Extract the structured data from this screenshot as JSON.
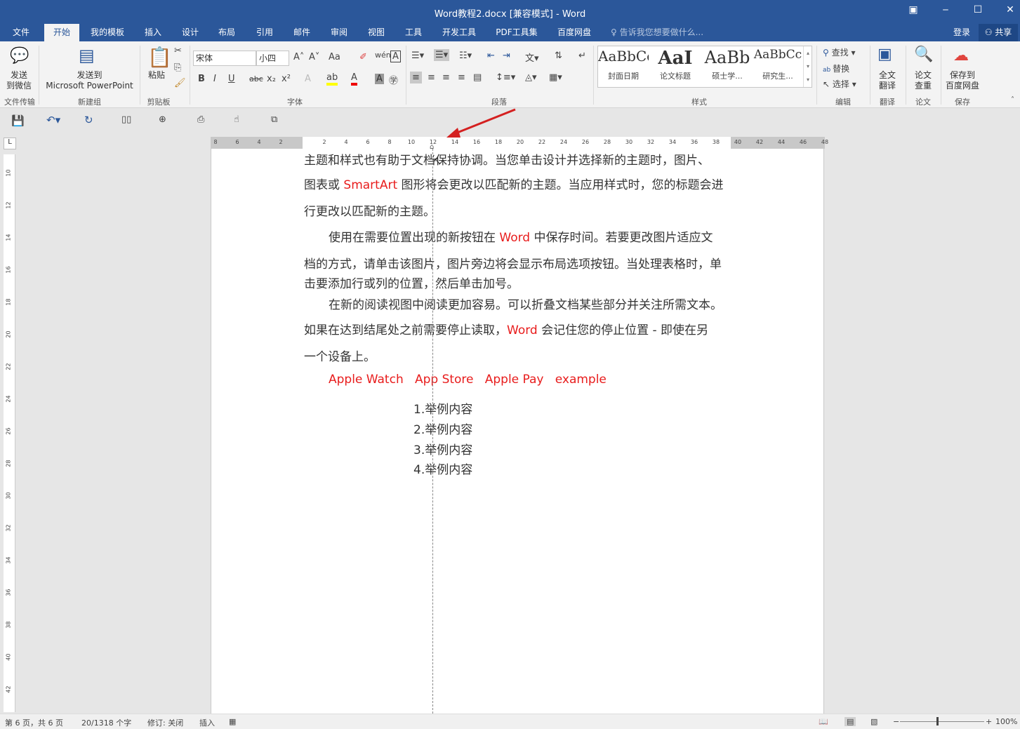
{
  "window": {
    "title": "Word教程2.docx [兼容模式] - Word",
    "restore_icon": "ribbon-display-icon",
    "min": "‒",
    "max": "☐",
    "close": "✕"
  },
  "tabs": [
    "文件",
    "开始",
    "我的模板",
    "插入",
    "设计",
    "布局",
    "引用",
    "邮件",
    "审阅",
    "视图",
    "工具",
    "开发工具",
    "PDF工具集",
    "百度网盘"
  ],
  "active_tab": "开始",
  "tell_me": "告诉我您想要做什么...",
  "login": "登录",
  "share": "共享",
  "ribbon": {
    "wechat": {
      "label1": "发送",
      "label2": "到微信",
      "group": "文件传输"
    },
    "ppt": {
      "label1": "发送到",
      "label2": "Microsoft PowerPoint",
      "group": "新建组"
    },
    "clipboard": {
      "paste": "粘贴",
      "group": "剪贴板"
    },
    "font": {
      "name": "宋体",
      "size": "小四",
      "group": "字体",
      "bold": "B",
      "italic": "I",
      "underline": "U",
      "strike": "abc",
      "sub": "x₂",
      "sup": "x²",
      "grow": "A˄",
      "shrink": "A˅",
      "case": "Aa",
      "color": "#e81c1c",
      "highlight": "#ffff00"
    },
    "paragraph": {
      "group": "段落"
    },
    "styles": {
      "group": "样式",
      "items": [
        {
          "preview": "AaBbCc",
          "label": "封面日期"
        },
        {
          "preview": "AaI",
          "label": "论文标题"
        },
        {
          "preview": "AaBb",
          "label": "硕士学..."
        },
        {
          "preview": "AaBbCc",
          "label": "研究生..."
        }
      ]
    },
    "editing": {
      "find": "查找",
      "replace": "替换",
      "select": "选择",
      "group": "编辑"
    },
    "translate": {
      "label1": "全文",
      "label2": "翻译",
      "group": "翻译"
    },
    "paper": {
      "label1": "论文",
      "label2": "查重",
      "group": "论文"
    },
    "baidu": {
      "label1": "保存到",
      "label2": "百度网盘",
      "group": "保存"
    }
  },
  "ruler": {
    "left": [
      "8",
      "6",
      "4",
      "2"
    ],
    "right": [
      "2",
      "4",
      "6",
      "8",
      "10",
      "12",
      "14",
      "16",
      "18",
      "20",
      "22",
      "24",
      "26",
      "28",
      "30",
      "32",
      "34",
      "36",
      "38",
      "40",
      "42",
      "44",
      "46",
      "48"
    ],
    "vertical": [
      "10",
      "12",
      "14",
      "16",
      "18",
      "20",
      "22",
      "24",
      "26",
      "28",
      "30",
      "32",
      "34",
      "36",
      "38",
      "40",
      "42"
    ]
  },
  "document": {
    "line0": "主题和样式也有助于文档保持协调。当您单击设计并选择新的主题时，图片、",
    "line1a": "图表或 ",
    "line1b": "SmartArt",
    "line1c": " 图形将会更改以匹配新的主题。当应用样式时，您的标题会进",
    "line2": "行更改以匹配新的主题。",
    "line3a": "使用在需要位置出现的新按钮在 ",
    "line3b": "Word",
    "line3c": " 中保存时间。若要更改图片适应文",
    "line4": "档的方式，请单击该图片，图片旁边将会显示布局选项按钮。当处理表格时，单",
    "line5": "击要添加行或列的位置，然后单击加号。",
    "line6": "在新的阅读视图中阅读更加容易。可以折叠文档某些部分并关注所需文本。",
    "line7a": "如果在达到结尾处之前需要停止读取，",
    "line7b": "Word",
    "line7c": " 会记住您的停止位置 - 即使在另",
    "line8": "一个设备上。",
    "tags": [
      "Apple Watch",
      "App Store",
      "Apple Pay",
      "example"
    ],
    "list": [
      "1.举例内容",
      "2.举例内容",
      "3.举例内容",
      "4.举例内容"
    ]
  },
  "status": {
    "page": "第 6 页，共 6 页",
    "words": "20/1318 个字",
    "track": "修订: 关闭",
    "mode": "插入",
    "zoom": "100%"
  }
}
